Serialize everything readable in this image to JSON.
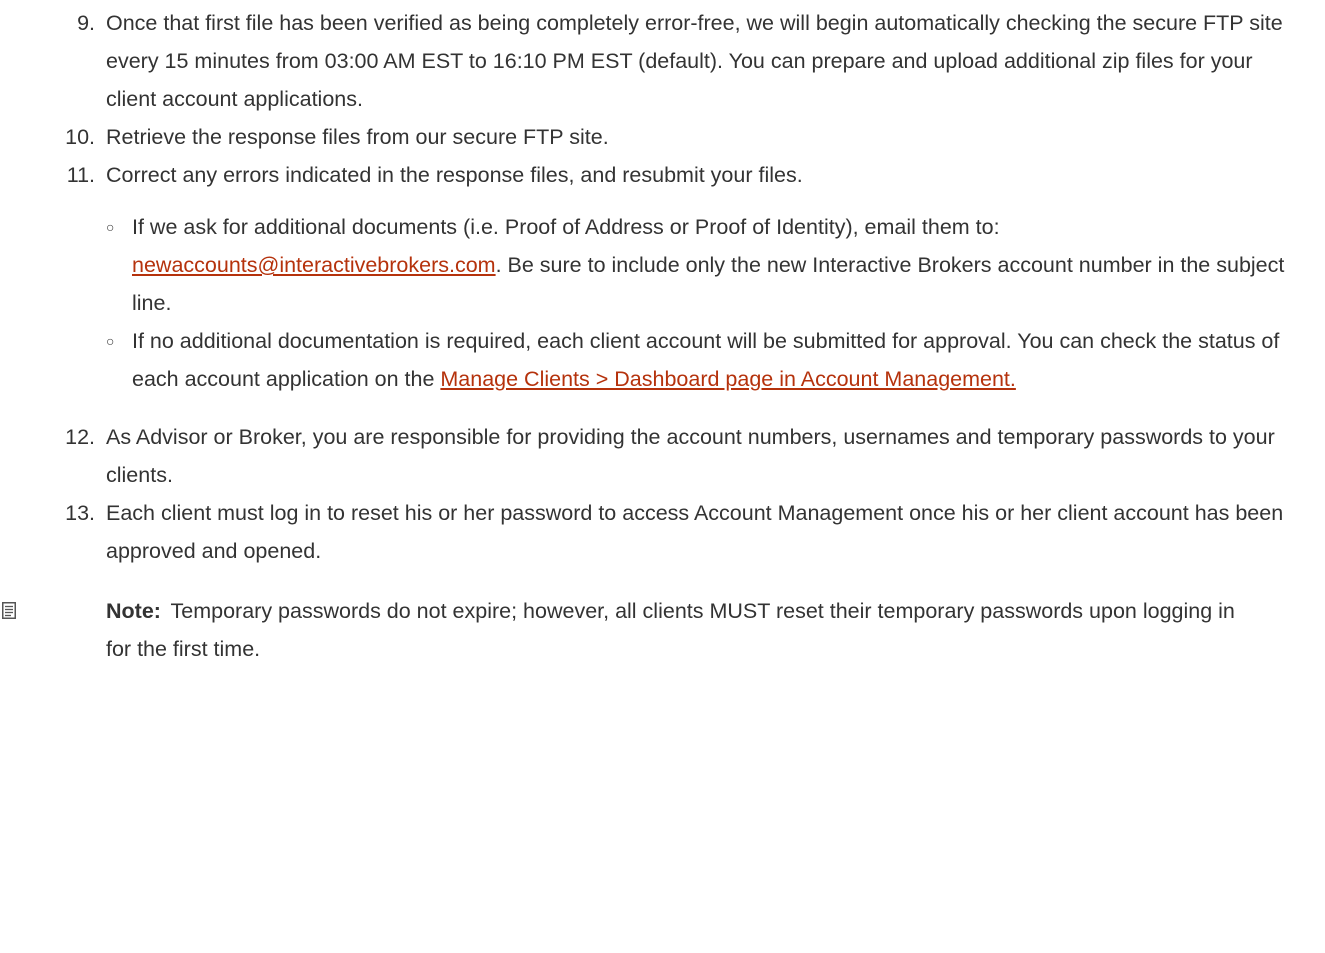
{
  "steps": [
    {
      "number": "9.",
      "text": "Once that first file has been verified as being completely error-free, we will begin automatically checking the secure FTP site every 15 minutes from 03:00 AM EST to 16:10 PM EST (default). You can prepare and upload additional zip files for your client account applications."
    },
    {
      "number": "10.",
      "text": "Retrieve the response files from our secure FTP site."
    },
    {
      "number": "11.",
      "text": "Correct any errors indicated in the response files, and resubmit your files.",
      "subitems": [
        {
          "text_before": "If we ask for additional documents (i.e. Proof of Address or Proof of Identity), email them to: ",
          "link": "newaccounts@interactivebrokers.com",
          "text_after": ". Be sure to include only the new Interactive Brokers account number in the subject line."
        },
        {
          "text_before": "If no additional documentation is required, each client account will be submitted for approval. You can check the status of each account application on the ",
          "link": "Manage Clients > Dashboard page in Account Management.",
          "text_after": ""
        }
      ]
    },
    {
      "number": "12.",
      "text": "As Advisor or Broker, you are responsible for providing the account numbers, usernames and temporary passwords to your clients."
    },
    {
      "number": "13.",
      "text": "Each client must log in to reset his or her password to access Account Management once his or her client account has been approved and opened."
    }
  ],
  "note": {
    "icon": "note-icon",
    "label": "Note:",
    "text": " Temporary passwords do not expire; however, all clients MUST reset their temporary passwords upon logging in for the first time."
  },
  "colors": {
    "text": "#333333",
    "link": "#b5320c"
  }
}
